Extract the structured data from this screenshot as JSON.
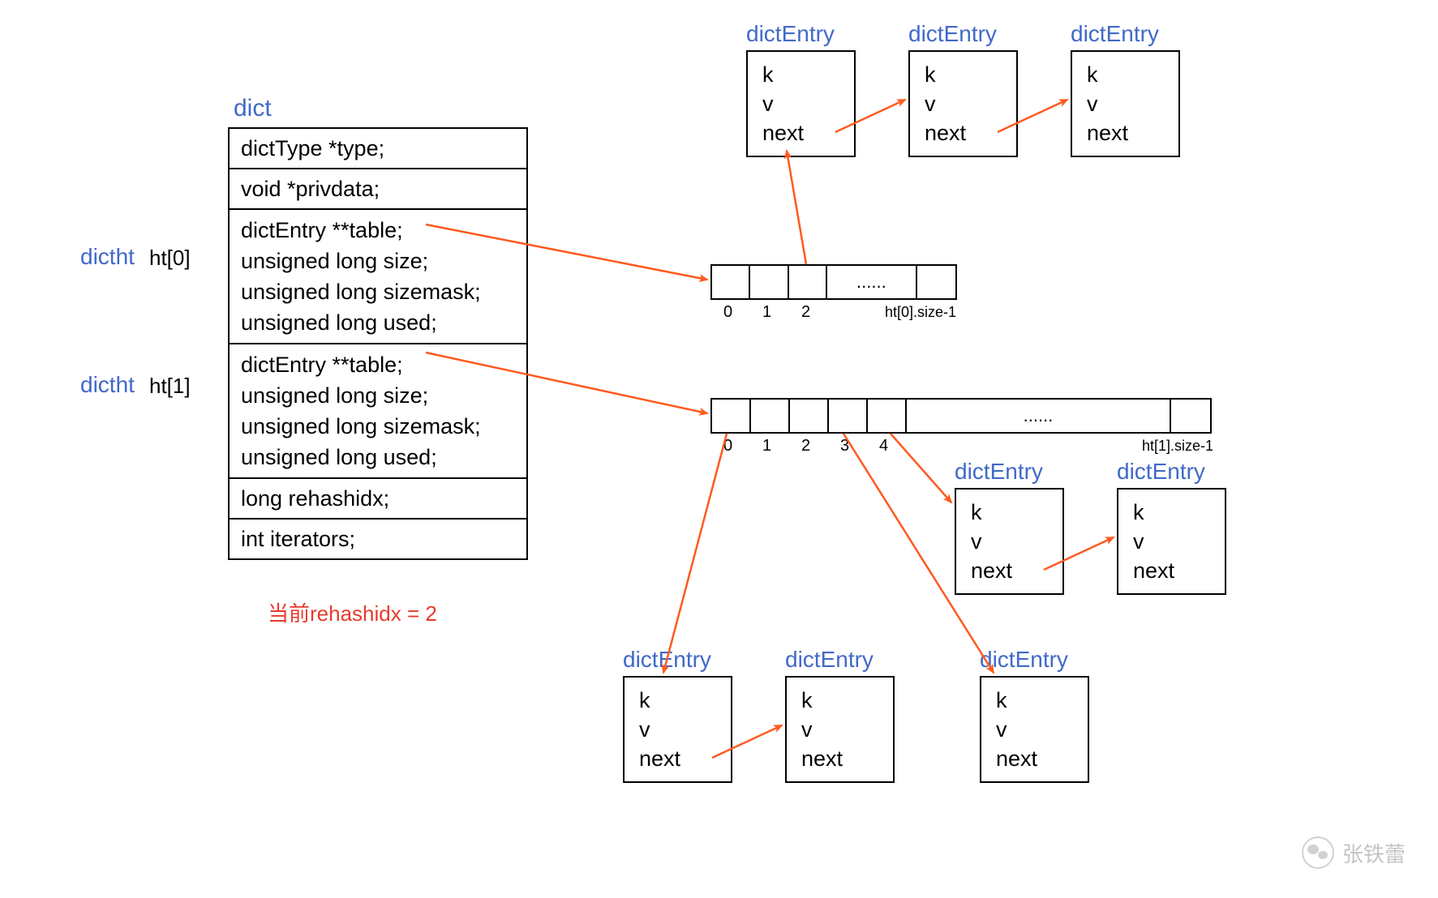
{
  "labels": {
    "dict": "dict",
    "dictht": "dictht",
    "ht0": "ht[0]",
    "ht1": "ht[1]",
    "dictEntry": "dictEntry"
  },
  "dict_struct": {
    "row_type": "dictType *type;",
    "row_privdata": "void *privdata;",
    "row_ht0_l1": "dictEntry **table;",
    "row_ht0_l2": "unsigned long size;",
    "row_ht0_l3": "unsigned long sizemask;",
    "row_ht0_l4": "unsigned long used;",
    "row_ht1_l1": "dictEntry **table;",
    "row_ht1_l2": "unsigned long size;",
    "row_ht1_l3": "unsigned long sizemask;",
    "row_ht1_l4": "unsigned long used;",
    "row_rehashidx": "long rehashidx;",
    "row_iterators": "int iterators;"
  },
  "entry_fields": {
    "k": "k",
    "v": "v",
    "next": "next"
  },
  "ht0_buckets": {
    "indices": [
      "0",
      "1",
      "2"
    ],
    "ellipsis": "......",
    "last_label": "ht[0].size-1"
  },
  "ht1_buckets": {
    "indices": [
      "0",
      "1",
      "2",
      "3",
      "4"
    ],
    "ellipsis": "......",
    "last_label": "ht[1].size-1"
  },
  "note_red": "当前rehashidx = 2",
  "watermark": "张铁蕾"
}
